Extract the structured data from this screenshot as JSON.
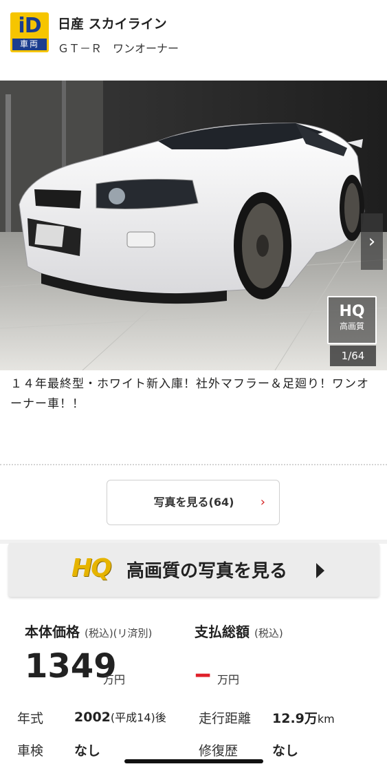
{
  "header": {
    "logo_id": "iD",
    "logo_sub": "車両",
    "title": "日産 スカイライン",
    "subtitle": "ＧＴ－Ｒ　ワンオーナー"
  },
  "gallery": {
    "counter": "1/64",
    "hq_badge": "HQ",
    "hq_badge_sub": "高画質",
    "next_icon": "chevron-right-icon"
  },
  "description": "１４年最終型・ホワイト新入庫！社外マフラー＆足廻り！ワンオーナー車！！",
  "photos_button": {
    "label": "写真を見る(64)",
    "chevron": "›"
  },
  "hq_banner": {
    "logo": "HQ",
    "text": "高画質の写真を見る"
  },
  "price": {
    "base_label": "本体価格",
    "base_note": "(税込)(リ済別)",
    "base_value": "1349",
    "base_unit": "万円",
    "total_label": "支払総額",
    "total_note": "(税込)",
    "total_value": "--",
    "total_unit": "万円"
  },
  "specs": {
    "year_label": "年式",
    "year_value": "2002",
    "year_note": "(平成14)後",
    "mileage_label": "走行距離",
    "mileage_value": "12.9万",
    "mileage_unit": "km",
    "inspection_label": "車検",
    "inspection_value": "なし",
    "repair_label": "修復歴",
    "repair_value": "なし"
  },
  "colors": {
    "accent_red": "#d42020",
    "hq_gold": "#e6b400",
    "logo_yellow": "#f6c500",
    "logo_blue": "#1b3d8f"
  }
}
